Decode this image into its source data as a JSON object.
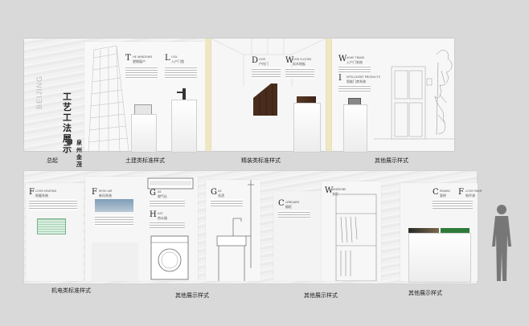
{
  "top_row": {
    "brand_vertical": "BEIJING",
    "title_main": "工艺工法展示",
    "logo_text": "泉州金茂",
    "panels": [
      {
        "letter": "T",
        "subtitle": "HE WINDOWS",
        "label": "塑钢窗户"
      },
      {
        "letter": "L",
        "subtitle": "OCK",
        "label": "入户门锁"
      },
      {
        "letter": "D",
        "subtitle": "OOR",
        "label": "户内门"
      },
      {
        "letter": "W",
        "subtitle": "OOD FLOORS",
        "label": "实木地板"
      },
      {
        "letter": "W",
        "subtitle": "ASHE TRANS",
        "label": "入户门系统"
      },
      {
        "letter": "I",
        "subtitle": "NTELLIGENT PRODUCTS",
        "label": "智能门禁系统"
      }
    ],
    "captions": [
      "总起",
      "土建类标准样式",
      "精装类标准样式",
      "其他展示样式"
    ]
  },
  "bottom_row": {
    "panels": [
      {
        "letter": "F",
        "subtitle": "LOOR HEATING",
        "label": "地暖系统"
      },
      {
        "letter": "F",
        "subtitle": "RESH AIR",
        "label": "新风系统"
      },
      {
        "letter": "G",
        "subtitle": "AS",
        "label": "燃气灶"
      },
      {
        "letter": "H",
        "subtitle": "EAT",
        "label": "热水器"
      },
      {
        "letter": "G",
        "subtitle": "AS",
        "label": "花洒"
      },
      {
        "letter": "C",
        "subtitle": "UPBOARD",
        "label": "橱柜"
      },
      {
        "letter": "W",
        "subtitle": "ARDROBE",
        "label": "衣柜"
      },
      {
        "letter": "C",
        "subtitle": "ERAMIC",
        "label": "瓷砖"
      },
      {
        "letter": "F",
        "subtitle": "LOOR PAINT",
        "label": "地坪漆"
      }
    ],
    "captions": [
      "机电类标准样式",
      "其他展示样式",
      "其他展示样式",
      "其他展示样式"
    ]
  }
}
